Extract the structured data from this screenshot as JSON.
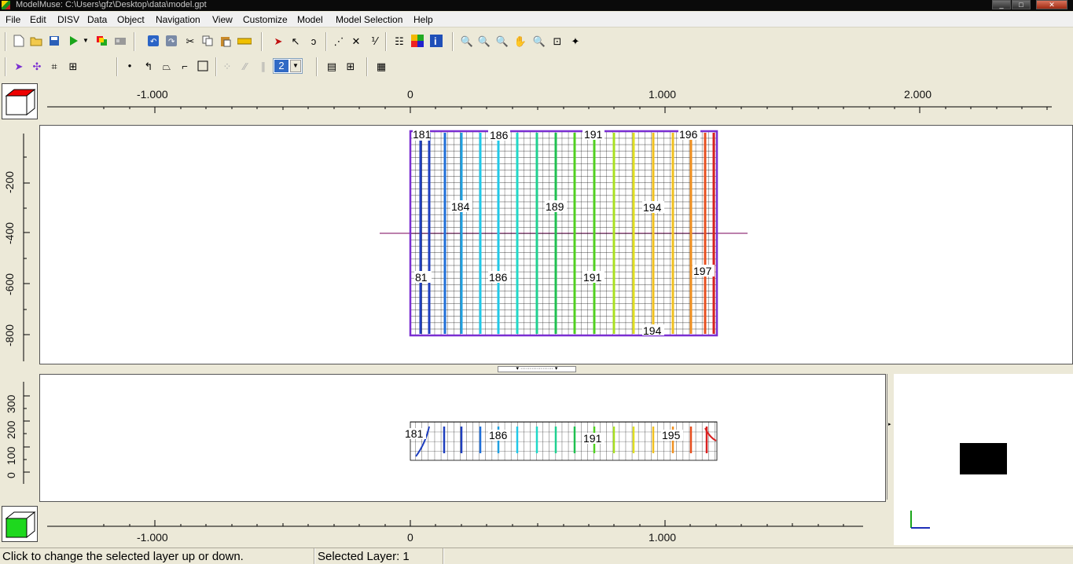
{
  "window": {
    "title": "ModelMuse: C:\\Users\\gfz\\Desktop\\data\\model.gpt",
    "minimize": "_",
    "maximize": "□",
    "close": "✕"
  },
  "menu": [
    "File",
    "Edit",
    "DISV",
    "Data",
    "Object",
    "Navigation",
    "View",
    "Customize",
    "Model",
    "Model Selection",
    "Help"
  ],
  "toolbar1": {
    "icons": [
      "new-file-icon",
      "open-folder-icon",
      "save-icon",
      "run-model-icon",
      "dropdown-arrow-icon",
      "export-icon",
      "import-icon",
      "undo-icon",
      "redo-icon",
      "cut-icon",
      "copy-icon",
      "paste-icon",
      "ruler-icon",
      "select-pointer-icon",
      "edit-vertices-icon",
      "lasso-icon",
      "add-vertex-icon",
      "delete-segment-icon",
      "split-icon",
      "layers-icon",
      "color-grid-icon",
      "info-icon",
      "zoom-in-icon",
      "zoom-icon",
      "zoom-out-icon",
      "pan-hand-icon",
      "zoom-extents-icon",
      "zoom-window-icon",
      "magic-wand-icon"
    ]
  },
  "toolbar2": {
    "icons": [
      "select-cell-icon",
      "move-vertex-icon",
      "grid-lines-icon",
      "grid-points-icon",
      "point-object-icon",
      "polyline-icon",
      "polygon-icon",
      "straight-line-icon",
      "rectangle-icon",
      "dotted-line-icon",
      "dashed-line-icon",
      "multi-line-icon"
    ],
    "layer_spin_value": "2",
    "layer_spin_arrow": "▼",
    "extra_icons": [
      "layer-lines-icon",
      "layer-grid-icon",
      "mesh-icon"
    ]
  },
  "top_ruler": {
    "labels": [
      "-1.000",
      "0",
      "1.000",
      "2.000"
    ]
  },
  "left_ruler": {
    "labels": [
      "-200",
      "-400",
      "-600",
      "-800"
    ]
  },
  "plan_view": {
    "contour_labels": [
      "181",
      "186",
      "191",
      "196",
      "184",
      "189",
      "194",
      "81",
      "186",
      "191",
      "197",
      "194"
    ]
  },
  "splitter": {
    "label": "▾ ·················· ▾"
  },
  "front_ruler": {
    "labels": [
      "300",
      "200",
      "100",
      "0"
    ]
  },
  "front_view": {
    "contour_labels": [
      "181",
      "186",
      "191",
      "195"
    ]
  },
  "bottom_ruler": {
    "labels": [
      "-1.000",
      "0",
      "1.000"
    ]
  },
  "status": {
    "hint": "Click to change the selected layer up or down.",
    "layer": "Selected Layer: 1"
  },
  "colors": {
    "grid_outline": "#7a2ed1",
    "contour_start": "#1f3fbf",
    "contour_end": "#d82020"
  }
}
